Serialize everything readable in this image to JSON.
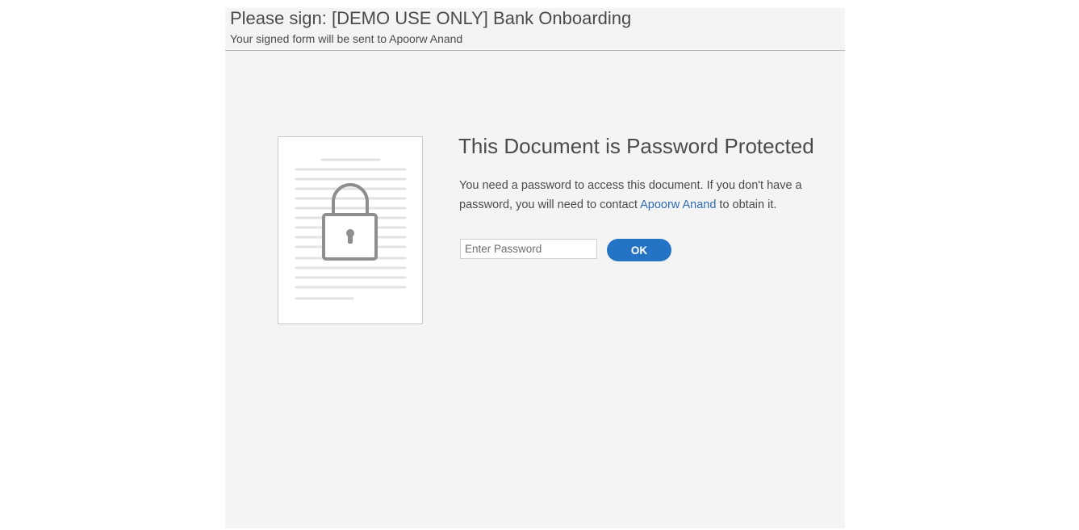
{
  "header": {
    "title": "Please sign: [DEMO USE ONLY] Bank Onboarding",
    "subtitle": "Your signed form will be sent to Apoorw Anand"
  },
  "protection": {
    "title": "This Document is Password Protected",
    "message_before": "You need a password to access this document. If you don't have a password, you will need to contact ",
    "contact_name": "Apoorw Anand",
    "message_after": " to obtain it.",
    "password_placeholder": "Enter Password",
    "password_value": "",
    "ok_label": "OK"
  },
  "icons": {
    "document": "document-icon",
    "lock": "lock-icon"
  },
  "colors": {
    "accent": "#2473c5",
    "link": "#2d6bb3",
    "panel_background": "#f4f4f4",
    "lock_gray": "#8e8e8e"
  }
}
